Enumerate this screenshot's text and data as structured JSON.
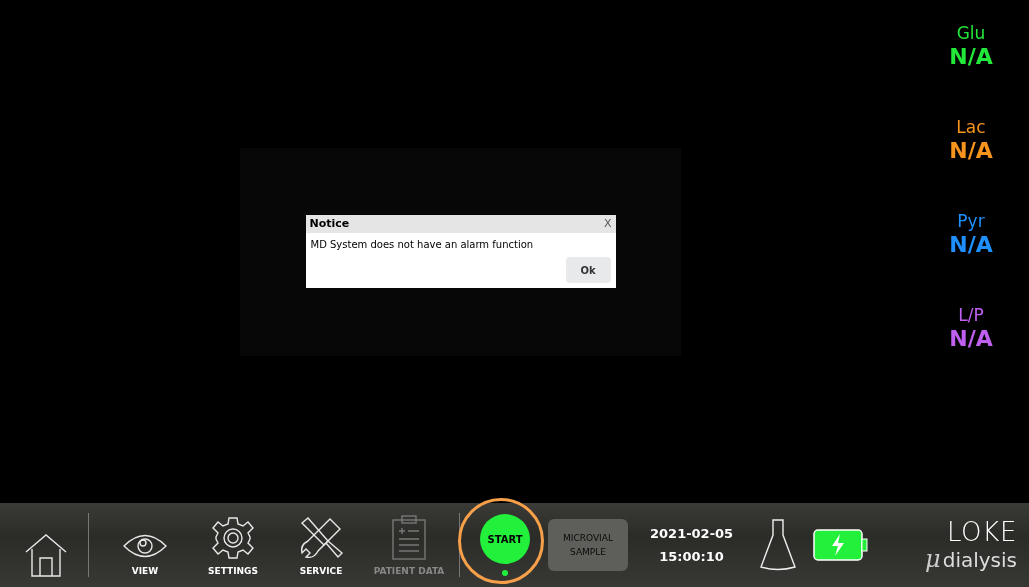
{
  "analytes": [
    {
      "name": "Glu",
      "value": "N/A",
      "color": "#22e83a"
    },
    {
      "name": "Lac",
      "value": "N/A",
      "color": "#f7941d"
    },
    {
      "name": "Pyr",
      "value": "N/A",
      "color": "#1e90ff"
    },
    {
      "name": "L/P",
      "value": "N/A",
      "color": "#c060f0"
    }
  ],
  "dialog": {
    "title": "Notice",
    "close": "X",
    "message": "MD System does not have an alarm function",
    "button": "Ok"
  },
  "nav": [
    {
      "kind": "home",
      "disabled": false
    },
    {
      "kind": "view",
      "label": "VIEW",
      "disabled": false
    },
    {
      "kind": "settings",
      "label": "SETTINGS",
      "disabled": false
    },
    {
      "kind": "service",
      "label": "SERVICE",
      "disabled": false
    },
    {
      "kind": "patient",
      "label": "PATIENT DATA",
      "disabled": true
    }
  ],
  "start_button": {
    "label": "START",
    "highlighted": true
  },
  "sample_button": {
    "label": "MICROVIAL SAMPLE",
    "disabled": true
  },
  "date": "2021-02-05",
  "time": "15:00:10",
  "logo": {
    "top": "LOKE",
    "mu": "μ",
    "bottom": "dialysis"
  }
}
